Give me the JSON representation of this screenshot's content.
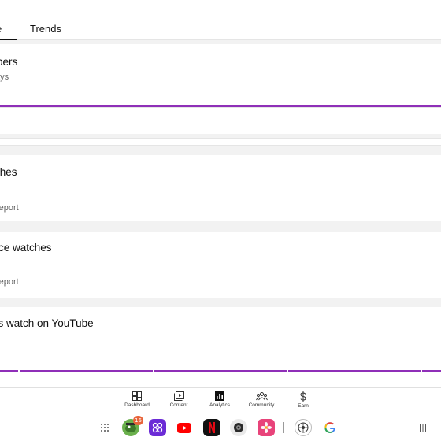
{
  "tabs": [
    {
      "label": "ence",
      "selected": true
    },
    {
      "label": "Trends",
      "selected": false
    }
  ],
  "cards": {
    "subscribers": {
      "title": "ibers",
      "subtitle": "ays"
    },
    "watches": {
      "title": "ches",
      "link": "report"
    },
    "audience_watches": {
      "title": "ence watches",
      "link": "report"
    },
    "watch_on_youtube": {
      "title": "rs watch on YouTube"
    }
  },
  "bottom_nav": [
    {
      "label": "Dashboard",
      "icon": "dashboard-icon"
    },
    {
      "label": "Content",
      "icon": "content-icon"
    },
    {
      "label": "Analytics",
      "icon": "analytics-icon",
      "selected": true
    },
    {
      "label": "Community",
      "icon": "community-icon"
    },
    {
      "label": "Earn",
      "icon": "earn-icon"
    }
  ],
  "dock": {
    "badge_count": "16",
    "apps": [
      "app-grid-icon",
      "game-app-icon",
      "bubble-app-icon",
      "youtube-app-icon",
      "netflix-app-icon",
      "camera-app-icon",
      "gallery-app-icon",
      "browser-app-icon",
      "google-app-icon",
      "recents-icon"
    ]
  },
  "colors": {
    "accent": "#8f2fb8",
    "youtube_red": "#ff0000",
    "netflix_red": "#e50914"
  }
}
